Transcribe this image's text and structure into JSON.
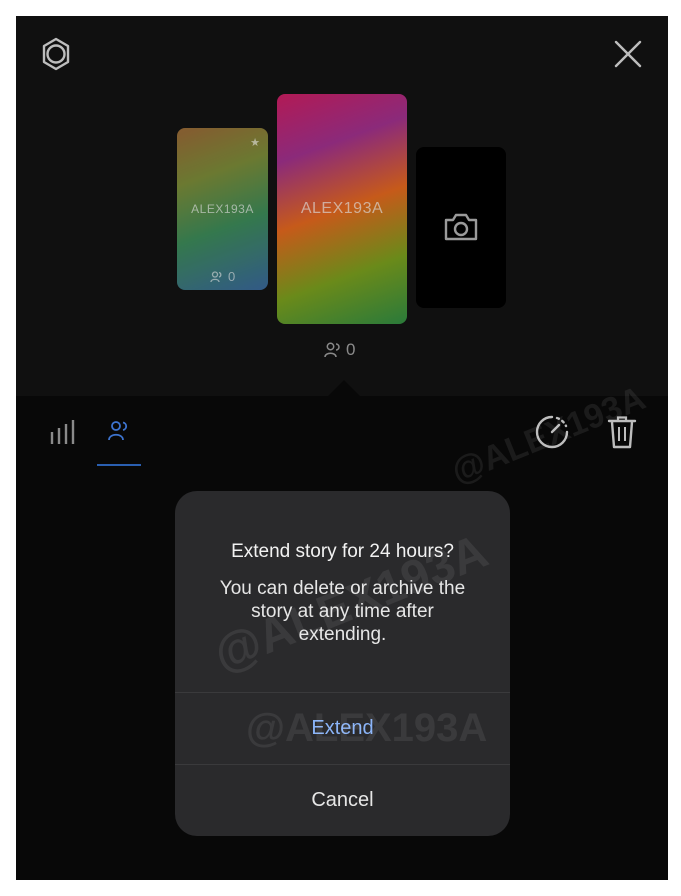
{
  "stories": [
    {
      "name": "ALEX193A",
      "views": "0"
    },
    {
      "name": "ALEX193A",
      "views": "0"
    }
  ],
  "icons": {
    "settings": "settings-icon",
    "close": "close-icon",
    "camera": "camera-icon",
    "stats": "bar-chart-icon",
    "viewers": "viewers-icon",
    "timer": "timer-icon",
    "delete": "trash-icon"
  },
  "watermark": {
    "text": "@ALEX193A"
  },
  "dialog": {
    "title": "Extend story for 24 hours?",
    "body": "You can delete or archive the story at any time after extending.",
    "extend_label": "Extend",
    "cancel_label": "Cancel"
  },
  "colors": {
    "accent": "#8ab4f8",
    "tab_underline": "#2a5fb0"
  }
}
